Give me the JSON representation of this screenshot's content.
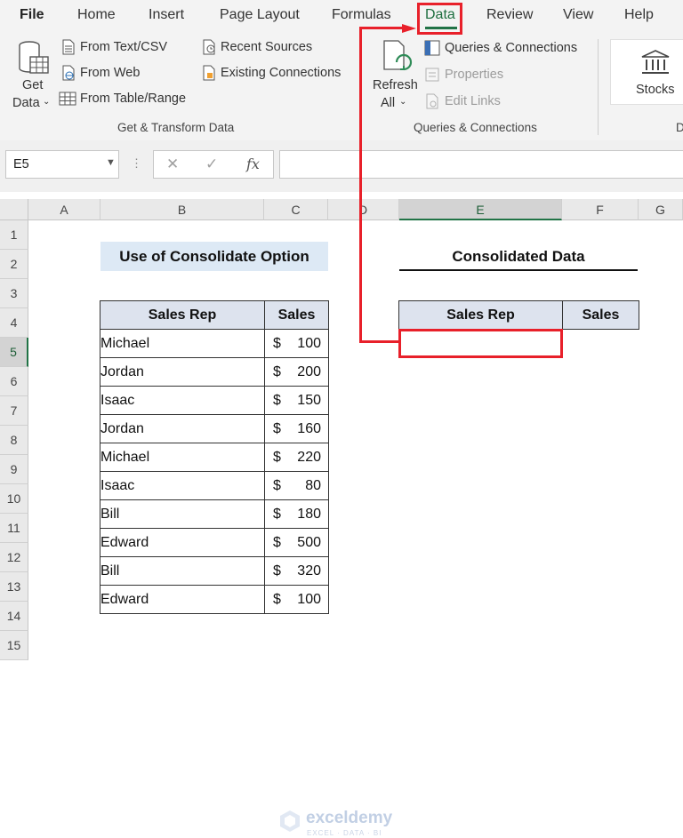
{
  "menu": {
    "tabs": [
      "File",
      "Home",
      "Insert",
      "Page Layout",
      "Formulas",
      "Data",
      "Review",
      "View",
      "Help"
    ],
    "active": "Data"
  },
  "ribbon": {
    "get_data_line1": "Get",
    "get_data_line2": "Data",
    "from_text_csv": "From Text/CSV",
    "from_web": "From Web",
    "from_table_range": "From Table/Range",
    "recent_sources": "Recent Sources",
    "existing_connections": "Existing Connections",
    "group_get_transform": "Get & Transform Data",
    "refresh_line1": "Refresh",
    "refresh_line2": "All",
    "queries_connections": "Queries & Connections",
    "properties": "Properties",
    "edit_links": "Edit Links",
    "group_queries": "Queries & Connections",
    "stocks": "Stocks",
    "group_cut": "D"
  },
  "formula_bar": {
    "name_box": "E5",
    "formula": ""
  },
  "columns": [
    "A",
    "B",
    "C",
    "D",
    "E",
    "F",
    "G"
  ],
  "rows": [
    "1",
    "2",
    "3",
    "4",
    "5",
    "6",
    "7",
    "8",
    "9",
    "10",
    "11",
    "12",
    "13",
    "14",
    "15"
  ],
  "sheet": {
    "title": "Use of Consolidate Option",
    "consolidated_title": "Consolidated Data",
    "headers": [
      "Sales Rep",
      "Sales"
    ],
    "currency": "$",
    "records": [
      {
        "rep": "Michael",
        "sales": "100"
      },
      {
        "rep": "Jordan",
        "sales": "200"
      },
      {
        "rep": "Isaac",
        "sales": "150"
      },
      {
        "rep": "Jordan",
        "sales": "160"
      },
      {
        "rep": "Michael",
        "sales": "220"
      },
      {
        "rep": "Isaac",
        "sales": "80"
      },
      {
        "rep": "Bill",
        "sales": "180"
      },
      {
        "rep": "Edward",
        "sales": "500"
      },
      {
        "rep": "Bill",
        "sales": "320"
      },
      {
        "rep": "Edward",
        "sales": "100"
      }
    ],
    "consolidated_headers": [
      "Sales Rep",
      "Sales"
    ]
  },
  "watermark": {
    "name": "exceldemy",
    "tagline": "EXCEL · DATA · BI"
  },
  "colors": {
    "accent_green": "#217346",
    "highlight_red": "#e8202a",
    "title_fill": "#dde9f5",
    "header_fill": "#dde3ee"
  }
}
